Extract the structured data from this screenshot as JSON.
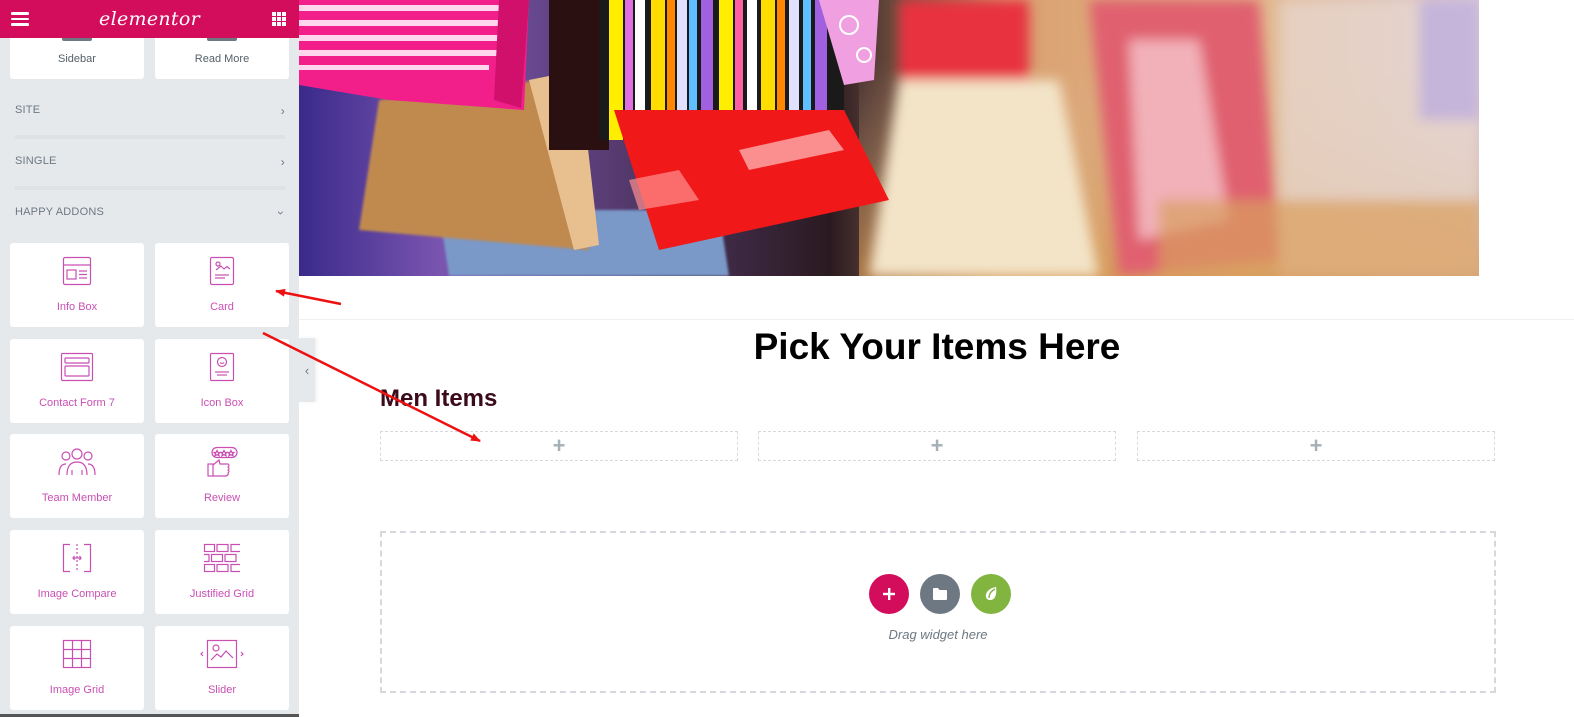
{
  "editor": {
    "logo_text": "elementor",
    "brand_color": "#d30c5c",
    "menu_icon": "hamburger-icon",
    "apps_icon": "grid-apps-icon"
  },
  "sidebar": {
    "top_widgets": [
      {
        "label": "Sidebar"
      },
      {
        "label": "Read More"
      }
    ],
    "sections": [
      {
        "label": "SITE",
        "state": "collapsed",
        "icon": "chevron-right-icon"
      },
      {
        "label": "SINGLE",
        "state": "collapsed",
        "icon": "chevron-right-icon"
      },
      {
        "label": "HAPPY ADDONS",
        "state": "expanded",
        "icon": "chevron-down-icon"
      }
    ],
    "happy_widgets": [
      {
        "label": "Info Box",
        "icon": "info-box-icon"
      },
      {
        "label": "Card",
        "icon": "card-icon"
      },
      {
        "label": "Contact Form 7",
        "icon": "contact-form-icon"
      },
      {
        "label": "Icon Box",
        "icon": "icon-box-icon"
      },
      {
        "label": "Team Member",
        "icon": "team-member-icon"
      },
      {
        "label": "Review",
        "icon": "review-icon"
      },
      {
        "label": "Image Compare",
        "icon": "image-compare-icon"
      },
      {
        "label": "Justified Grid",
        "icon": "justified-grid-icon"
      },
      {
        "label": "Image Grid",
        "icon": "image-grid-icon"
      },
      {
        "label": "Slider",
        "icon": "slider-icon"
      }
    ],
    "collapse_icon": "chevron-left-icon",
    "widget_accent": "#c94fb3"
  },
  "canvas": {
    "hero_image_alt": "shopping bags",
    "page_title": "Pick Your Items Here",
    "subheading": "Men Items",
    "column_add_symbol": "+",
    "drop_zone": {
      "text": "Drag widget here",
      "buttons": [
        {
          "name": "add-section",
          "icon": "plus-icon",
          "color": "#d30c5c"
        },
        {
          "name": "add-template",
          "icon": "folder-icon",
          "color": "#6d7882"
        },
        {
          "name": "envato-kit",
          "icon": "envato-leaf-icon",
          "color": "#82b440"
        }
      ]
    }
  },
  "annotations": {
    "arrow_color": "#ee1111"
  }
}
